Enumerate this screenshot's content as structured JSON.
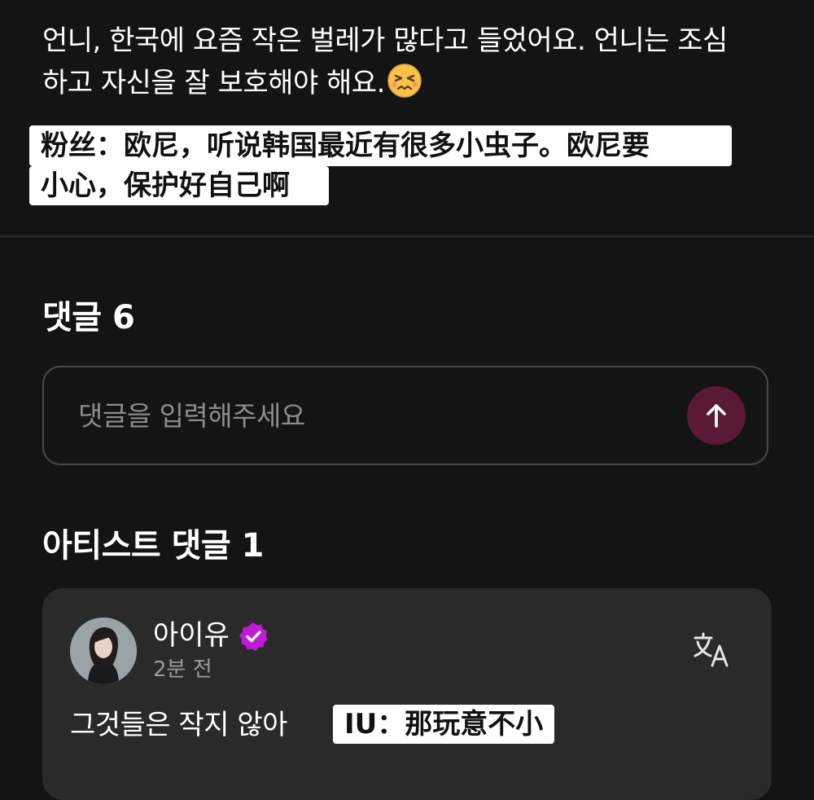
{
  "post": {
    "text_line1": "언니, 한국에 요즘 작은 벌레가 많다고 들었어요. 언니는 조심",
    "text_line2": "하고 자신을 잘 보호해야 해요.",
    "caption_line1": "粉丝：欧尼，听说韩国最近有很多小虫子。欧尼要",
    "caption_line2": "小心，保护好自己啊"
  },
  "comments": {
    "title": "댓글 6",
    "input_placeholder": "댓글을 입력해주세요"
  },
  "artist_comments": {
    "title": "아티스트 댓글 1",
    "items": [
      {
        "author": "아이유",
        "time": "2분 전",
        "text": "그것들은 작지 않아",
        "caption": "IU：那玩意不小"
      }
    ]
  },
  "icons": {
    "emoji": "persevering-face-emoji",
    "send": "arrow-up-icon",
    "verified": "verified-badge-icon",
    "translate": "translate-icon"
  },
  "colors": {
    "background": "#141414",
    "card": "#2a2a2a",
    "send_button": "#5a1a36",
    "verified": "#c21bd8",
    "caption_bg": "#ffffff"
  }
}
